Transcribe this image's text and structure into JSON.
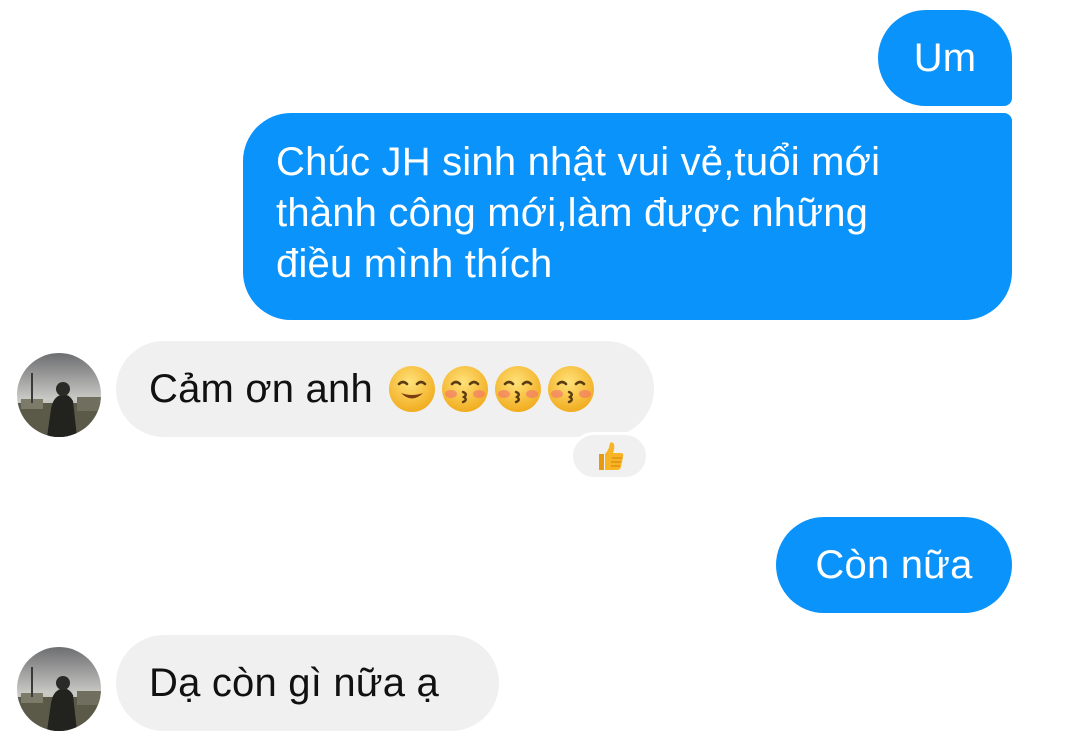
{
  "messages": {
    "out_1": "Um",
    "out_2_line_1": "Chúc JH sinh nhật vui vẻ,tuổi mới",
    "out_2_line_2": "thành công mới,làm được những",
    "out_2_line_3": "điều mình thích",
    "in_1": "Cảm ơn anh",
    "in_1_emojis": [
      "smiling-face-icon",
      "kissing-face-icon",
      "kissing-face-icon",
      "kissing-face-icon"
    ],
    "out_3": "Còn nữa",
    "in_2": "Dạ còn gì nữa ạ"
  },
  "reaction": {
    "icon": "thumbs-up-icon"
  },
  "colors": {
    "outgoing_bubble": "#0a93fb",
    "incoming_bubble": "#f0f0f1",
    "emoji_yellow": "#f7c33b"
  }
}
